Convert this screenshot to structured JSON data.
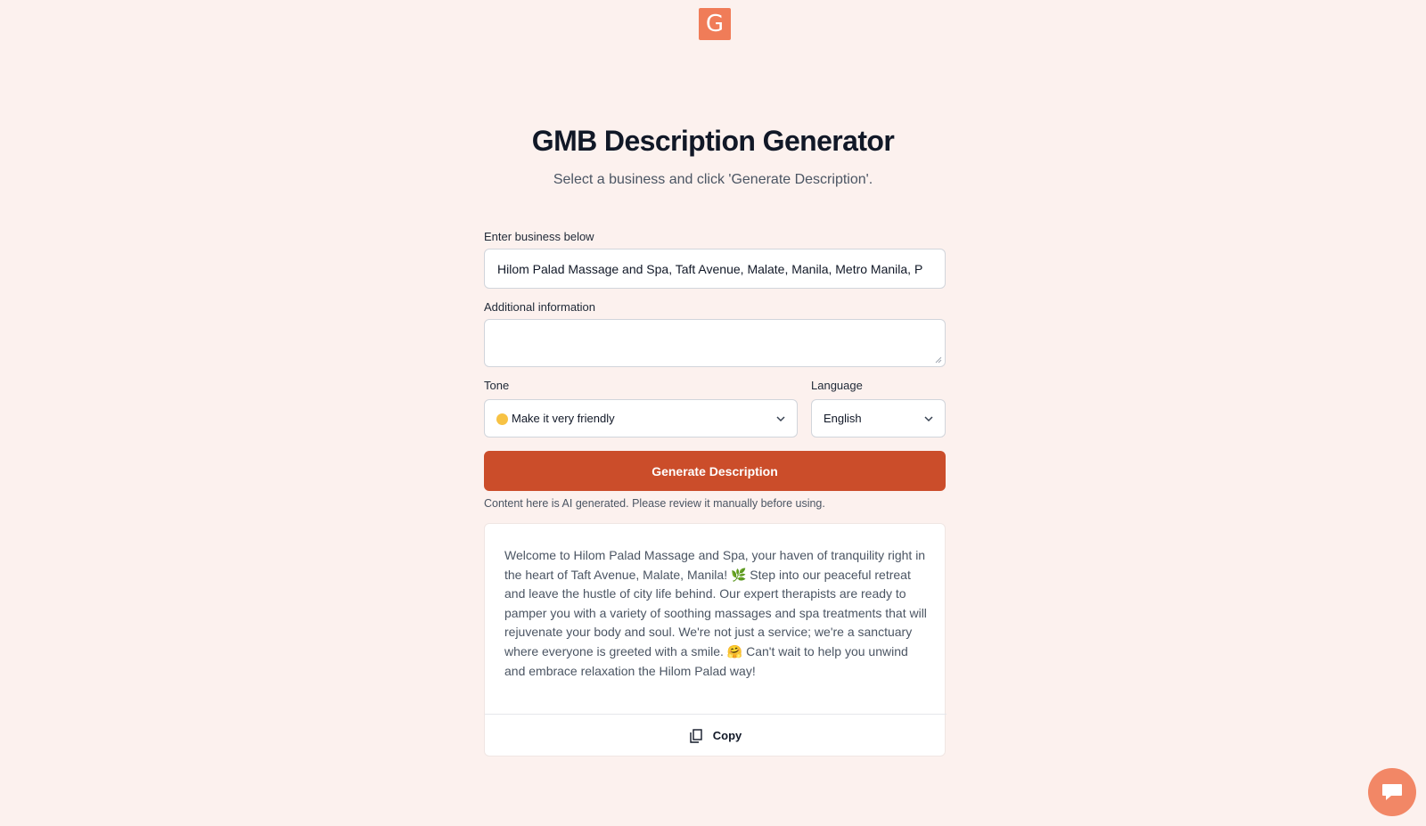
{
  "logo": {
    "letter": "G",
    "color": "#f07c58"
  },
  "header": {
    "title": "GMB Description Generator",
    "subtitle": "Select a business and click 'Generate Description'."
  },
  "form": {
    "business_label": "Enter business below",
    "business_value": "Hilom Palad Massage and Spa, Taft Avenue, Malate, Manila, Metro Manila, P",
    "additional_label": "Additional information",
    "additional_value": "",
    "tone_label": "Tone",
    "tone_value": "Make it very friendly",
    "language_label": "Language",
    "language_value": "English",
    "generate_label": "Generate Description",
    "accent_color": "#cb4d2a"
  },
  "notice": "Content here is AI generated. Please review it manually before using.",
  "result": {
    "text": "Welcome to Hilom Palad Massage and Spa, your haven of tranquility right in the heart of Taft Avenue, Malate, Manila! 🌿 Step into our peaceful retreat and leave the hustle of city life behind. Our expert therapists are ready to pamper you with a variety of soothing massages and spa treatments that will rejuvenate your body and soul. We're not just a service; we're a sanctuary where everyone is greeted with a smile. 🤗 Can't wait to help you unwind and embrace relaxation the Hilom Palad way!",
    "copy_label": "Copy"
  },
  "icons": {
    "copy": "copy-icon",
    "chevron": "chevron-down-icon",
    "chat": "chat-icon"
  }
}
